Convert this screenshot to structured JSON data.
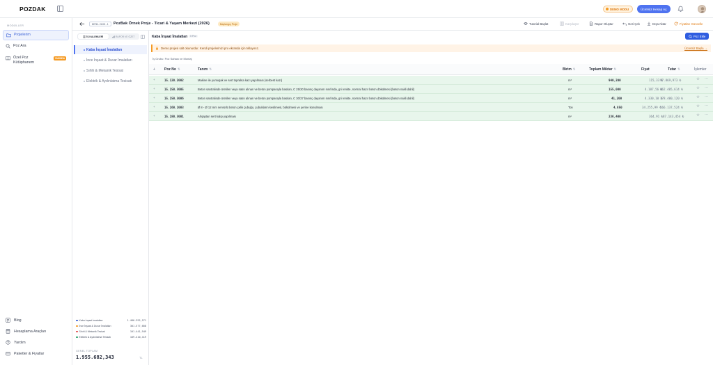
{
  "app": {
    "logo": "POZDAK"
  },
  "topbar": {
    "demo_badge": "DEMO MODU",
    "free_account": "Ücretsiz Hesap Aç"
  },
  "sidebar": {
    "modules_label": "MODÜLLER",
    "items": [
      {
        "label": "Projelerim",
        "icon": "folder-icon",
        "active": true
      },
      {
        "label": "Poz Ara",
        "icon": "search-icon"
      },
      {
        "label": "Özel Poz Kütüphanem",
        "icon": "book-icon",
        "badge": "YAKINDA"
      }
    ],
    "bottom": [
      {
        "label": "Blog",
        "icon": "blog-icon"
      },
      {
        "label": "Hesaplama Araçları",
        "icon": "calculator-icon"
      },
      {
        "label": "Yardım",
        "icon": "help-icon"
      },
      {
        "label": "Paketler & Fiyatlar",
        "icon": "package-icon"
      }
    ]
  },
  "project": {
    "code": "DEMO-2026-1",
    "title": "PozBak Örnek Proje - Ticari & Yaşam Merkezi (2026)",
    "status": "Başlangıç Proje",
    "tools": {
      "tutorial": "Tutorial Başlat",
      "compare": "Karşılaştır",
      "report": "Rapor Oluştur",
      "undo": "Geri Çek",
      "export": "Dışa Aktar",
      "update_prices": "Fiyatları Güncelle"
    }
  },
  "chapters": {
    "tabs": [
      "İŞ KALEMLERİ",
      "RAPOR VE ÖZET"
    ],
    "items": [
      {
        "label": "Kaba İnşaat İmalatları",
        "active": true
      },
      {
        "label": "İnce İnşaat & Duvar İmalatları"
      },
      {
        "label": "Sıhhi & Mekanik Tesisat"
      },
      {
        "label": "Elektrik & Aydınlatma Tesisatı"
      }
    ],
    "summary": [
      {
        "label": "Kaba İnşaat İmalatları",
        "value": "1.480.392,571",
        "color": "#3c63d8"
      },
      {
        "label": "İnce İnşaat & Duvar İmalatları",
        "value": "301.577,608",
        "color": "#f59a23"
      },
      {
        "label": "Sıhhi & Mekanik Tesisat",
        "value": "101.441,949",
        "color": "#e24a4a"
      },
      {
        "label": "Elektrik & Aydınlatma Tesisatı",
        "value": "109.410,419",
        "color": "#22a06b"
      }
    ],
    "total_label": "GENEL TOPLAM",
    "total_value": "1.955.682,343",
    "total_currency": "TL"
  },
  "content": {
    "section_title": "Kaba İnşaat İmalatları",
    "count_chip": "5 Poz",
    "add_button": "Poz Ekle",
    "warning": "Demo projesi salt okunurdur. Kendi projelerinizi pro ekranda için tıklayınız.",
    "warning_link": "Ücretsiz Başla →",
    "subtitle": "İş Grubu: Poz Sahası ve Montaj"
  },
  "table": {
    "headers": {
      "poz_no": "Poz No",
      "tanim": "Tanım",
      "birim": "Birim",
      "toplam_miktar": "Toplam Miktar",
      "fiyat": "Fiyat",
      "tutar": "Tutar",
      "islemler": "İşlemler"
    },
    "rows": [
      {
        "poz_no": "15.120.2002",
        "tanim": "Makine ile yumuşak ve sert toprakta kazı yapılması (serbest kazı)",
        "birim": "m³",
        "miktar": "940,200",
        "fiyat": "115,33 ₺",
        "tutar": "97.869,973 ₺"
      },
      {
        "poz_no": "15.150.3005",
        "tanim": "Beton santralinde üretilen veya satın alınan ve beton pompasıyla basılan, C 25/30 basınç dayanım sınıfında, gri renkte, normal hazır beton dökülmesi (beton nakli dahil)",
        "birim": "m³",
        "miktar": "155,000",
        "fiyat": "4.187,56 ₺",
        "tutar": "662.405,614 ₺"
      },
      {
        "poz_no": "15.150.3006",
        "tanim": "Beton santralinde üretilen veya satın alınan ve beton pompasıyla basılan, C 30/37 basınç dayanım sınıfında, gri renkte, normal hazır beton dökülmesi (beton nakli dahil)",
        "birim": "m³",
        "miktar": "41,200",
        "fiyat": "4.330,10 ₺",
        "tutar": "178.400,120 ₺"
      },
      {
        "poz_no": "15.160.1003",
        "tanim": "Ø 8 - Ø 12 mm nervürlü beton çelik çubuğu, çubukların kesilmesi, bükülmesi ve yerine konulması",
        "birim": "Ton",
        "miktar": "4,850",
        "fiyat": "34.255,99 ₺",
        "tutar": "166.137,524 ₺"
      },
      {
        "poz_no": "15.180.3001",
        "tanim": "Ahşaptan sert kalıp yapılması",
        "birim": "m²",
        "miktar": "236,400",
        "fiyat": "364,91 ₺",
        "tutar": "87.143,454 ₺"
      }
    ]
  }
}
